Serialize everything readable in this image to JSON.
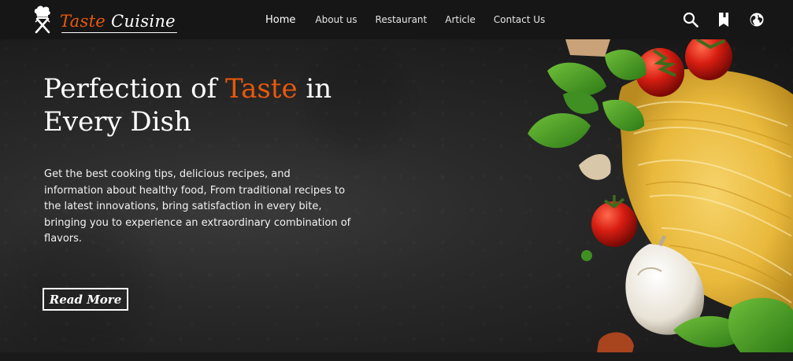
{
  "brand": {
    "name_part1": "Taste",
    "name_part2": "Cuisine",
    "logo_icon": "chef-hat-utensils-icon"
  },
  "nav": {
    "links": [
      "Home",
      "About us",
      "Restaurant",
      "Article",
      "Contact Us"
    ],
    "active": "Home",
    "icons": [
      "search-icon",
      "bookmark-icon",
      "globe-icon"
    ]
  },
  "hero": {
    "title_before": "Perfection of ",
    "title_accent": "Taste",
    "title_after": " in Every Dish",
    "description": "Get the best cooking tips, delicious recipes, and information about healthy food, From traditional recipes to the latest innovations, bring satisfaction in every bite, bringing you to experience an extraordinary combination of flavors.",
    "cta_label": "Read More"
  },
  "colors": {
    "accent": "#e8590c",
    "navbar": "#161616",
    "hero_bg": "#262626"
  }
}
